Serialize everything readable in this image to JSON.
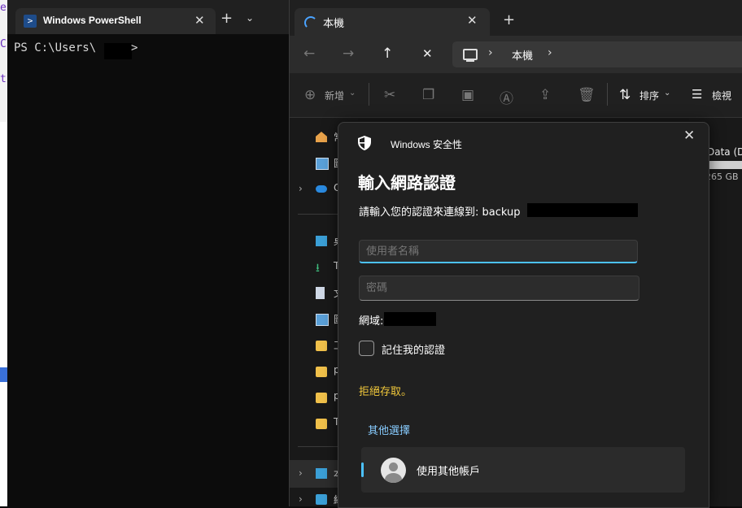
{
  "terminal": {
    "tab_title": "Windows PowerShell",
    "tab_close": "✕",
    "new_tab": "+",
    "dropdown": "⌄",
    "prompt": "PS C:\\Users\\",
    "prompt_end": ">"
  },
  "explorer": {
    "tab_title": "本機",
    "tab_close": "✕",
    "new_tab": "+",
    "address_path": "本機",
    "toolbar": {
      "new_label": "新增",
      "sort_label": "排序",
      "view_label": "檢視"
    },
    "nav_items": [
      {
        "label": "常",
        "icon": "home-icon"
      },
      {
        "label": "圖",
        "icon": "gallery-icon"
      },
      {
        "label": "O",
        "icon": "onedrive-icon"
      },
      {
        "label": "桌",
        "icon": "desktop-icon"
      },
      {
        "label": "T",
        "icon": "download-icon"
      },
      {
        "label": "文",
        "icon": "document-icon"
      },
      {
        "label": "圖",
        "icon": "pictures-icon"
      },
      {
        "label": "工",
        "icon": "folder-icon"
      },
      {
        "label": "p",
        "icon": "folder-icon"
      },
      {
        "label": "p",
        "icon": "folder-icon"
      },
      {
        "label": "T",
        "icon": "folder-icon"
      },
      {
        "label": "本",
        "icon": "this-pc-icon"
      },
      {
        "label": "網",
        "icon": "network-icon"
      }
    ],
    "drive_label": "Data (D:",
    "drive_size": "265 GB",
    "drive_fill": 1.0
  },
  "dialog": {
    "app_name": "Windows 安全性",
    "close": "✕",
    "title": "輸入網路認證",
    "description": "請輸入您的認證來連線到: backup",
    "username_placeholder": "使用者名稱",
    "password_placeholder": "密碼",
    "domain_label": "網域:",
    "remember_label": "記住我的認證",
    "deny_text": "拒絕存取。",
    "more_choices": "其他選擇",
    "other_account": "使用其他帳戶"
  }
}
